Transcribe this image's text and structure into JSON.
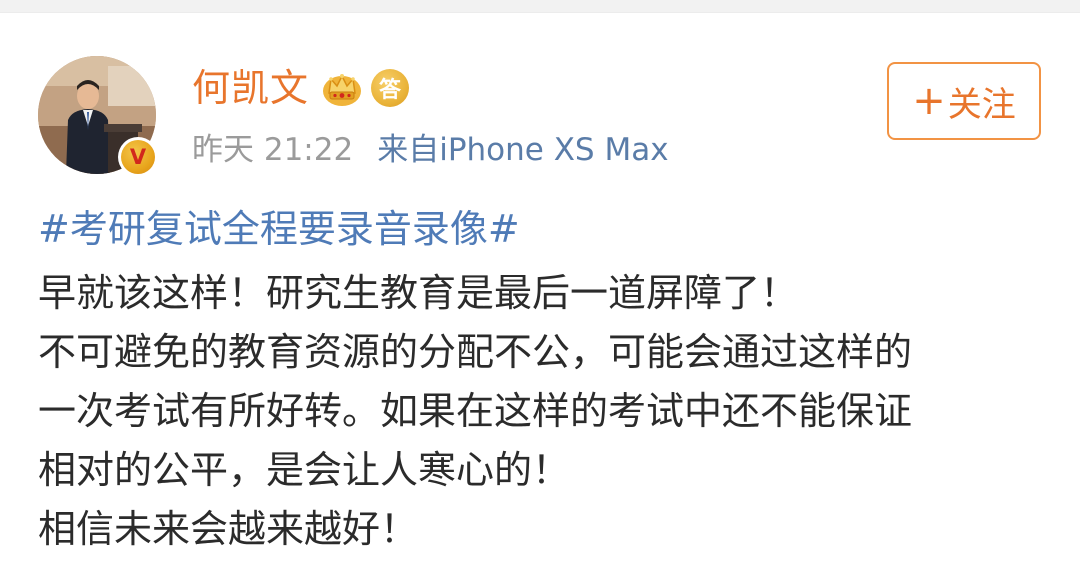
{
  "user": {
    "name": "何凯文",
    "badge_answer": "答",
    "verified_mark": "V",
    "avatar_icon": "person-avatar",
    "crown_icon": "crown-badge"
  },
  "meta": {
    "time": "昨天 21:22",
    "source": "来自iPhone XS Max"
  },
  "follow_button": {
    "plus": "+",
    "label": "关注"
  },
  "post": {
    "hashtag": "#考研复试全程要录音录像#",
    "lines": [
      "早就该这样！研究生教育是最后一道屏障了！",
      "不可避免的教育资源的分配不公，可能会通过这样的",
      "一次考试有所好转。如果在这样的考试中还不能保证",
      "相对的公平，是会让人寒心的！",
      "相信未来会越来越好！"
    ]
  },
  "colors": {
    "username": "#e8752c",
    "link": "#4f7bb7",
    "meta": "#9b9b9b",
    "body": "#2b2b2b",
    "follow_border": "#f29344"
  }
}
